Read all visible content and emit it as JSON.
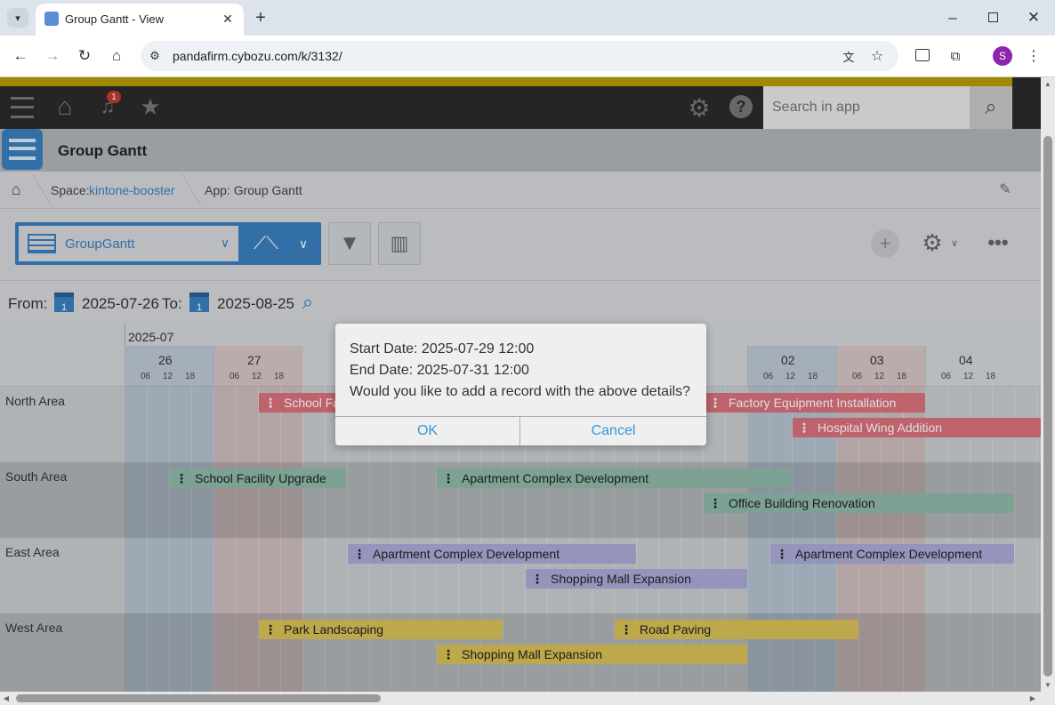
{
  "browser": {
    "tab_title": "Group Gantt - View",
    "url": "pandafirm.cybozu.com/k/3132/",
    "profile_initial": "S",
    "profile_color": "#8e24aa"
  },
  "header": {
    "notification_count": "1",
    "search_placeholder": "Search in app"
  },
  "app": {
    "title": "Group Gantt",
    "breadcrumb_space_prefix": "Space:",
    "breadcrumb_space": "kintone-booster",
    "breadcrumb_app": "App: Group Gantt"
  },
  "toolbar": {
    "view_name": "GroupGantt"
  },
  "filter": {
    "from_label": "From:",
    "from_date": "2025-07-26",
    "to_label": "To:",
    "to_date": "2025-08-25"
  },
  "gantt": {
    "month_label": "2025-07",
    "days": [
      {
        "label": "26"
      },
      {
        "label": "27"
      },
      {
        "label": "02"
      },
      {
        "label": "03"
      },
      {
        "label": "04"
      }
    ],
    "hours": [
      "06",
      "12",
      "18"
    ],
    "rows": [
      {
        "label": "North Area",
        "bars": [
          {
            "label": "School Facility Upgrade"
          },
          {
            "label": "Factory Equipment Installation"
          },
          {
            "label": "Hospital Wing Addition"
          }
        ]
      },
      {
        "label": "South Area",
        "bars": [
          {
            "label": "School Facility Upgrade"
          },
          {
            "label": "Apartment Complex Development"
          },
          {
            "label": "Office Building Renovation"
          }
        ]
      },
      {
        "label": "East Area",
        "bars": [
          {
            "label": "Apartment Complex Development"
          },
          {
            "label": "Apartment Complex Development"
          },
          {
            "label": "Shopping Mall Expansion"
          }
        ]
      },
      {
        "label": "West Area",
        "bars": [
          {
            "label": "Park Landscaping"
          },
          {
            "label": "Road Paving"
          },
          {
            "label": "Shopping Mall Expansion"
          }
        ]
      }
    ]
  },
  "dialog": {
    "line1": "Start Date: 2025-07-29 12:00",
    "line2": "End Date: 2025-07-31 12:00",
    "line3": "Would you like to add a record with the above details?",
    "ok": "OK",
    "cancel": "Cancel"
  },
  "colors": {
    "north": "#d9707a",
    "south": "#8fb8a8",
    "east": "#a9a9d8",
    "west": "#d9c057",
    "accent": "#3498db"
  }
}
